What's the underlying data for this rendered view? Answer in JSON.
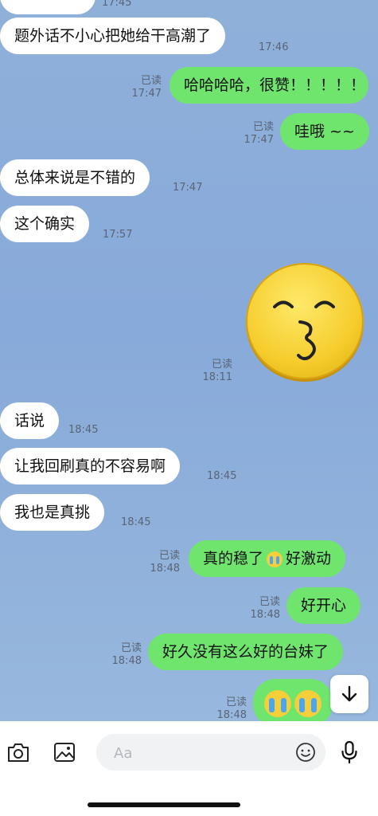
{
  "messages": [
    {
      "text": "",
      "time": "17:45"
    },
    {
      "text": "题外话不小心把她给干高潮了",
      "time": "17:46"
    },
    {
      "text": "哈哈哈哈，很赞！！！！！",
      "read": "已读",
      "time": "17:47"
    },
    {
      "text": "哇哦 ~~",
      "read": "已读",
      "time": "17:47"
    },
    {
      "text": "总体来说是不错的",
      "time": "17:47"
    },
    {
      "text": "这个确实",
      "time": "17:57"
    },
    {
      "sticker": "kissing-face-sticker",
      "read": "已读",
      "time": "18:11"
    },
    {
      "text": "话说",
      "time": "18:45"
    },
    {
      "text": "让我回刷真的不容易啊",
      "time": "18:45"
    },
    {
      "text": "我也是真挑",
      "time": "18:45"
    },
    {
      "text_a": "真的稳了",
      "text_b": "好激动",
      "read": "已读",
      "time": "18:48"
    },
    {
      "text": "好开心",
      "read": "已读",
      "time": "18:48"
    },
    {
      "text": "好久没有这么好的台妹了",
      "read": "已读",
      "time": "18:48"
    },
    {
      "emoji": "crying-face-emoji",
      "read": "已读",
      "time": "18:48"
    }
  ],
  "composer": {
    "placeholder": "Aa"
  },
  "icons": [
    "camera-icon",
    "image-icon",
    "smiley-icon",
    "microphone-icon",
    "arrow-down-icon"
  ],
  "colors": {
    "outgoing": "#6fe56e",
    "incoming": "#ffffff",
    "background": "#8fb0d9"
  }
}
